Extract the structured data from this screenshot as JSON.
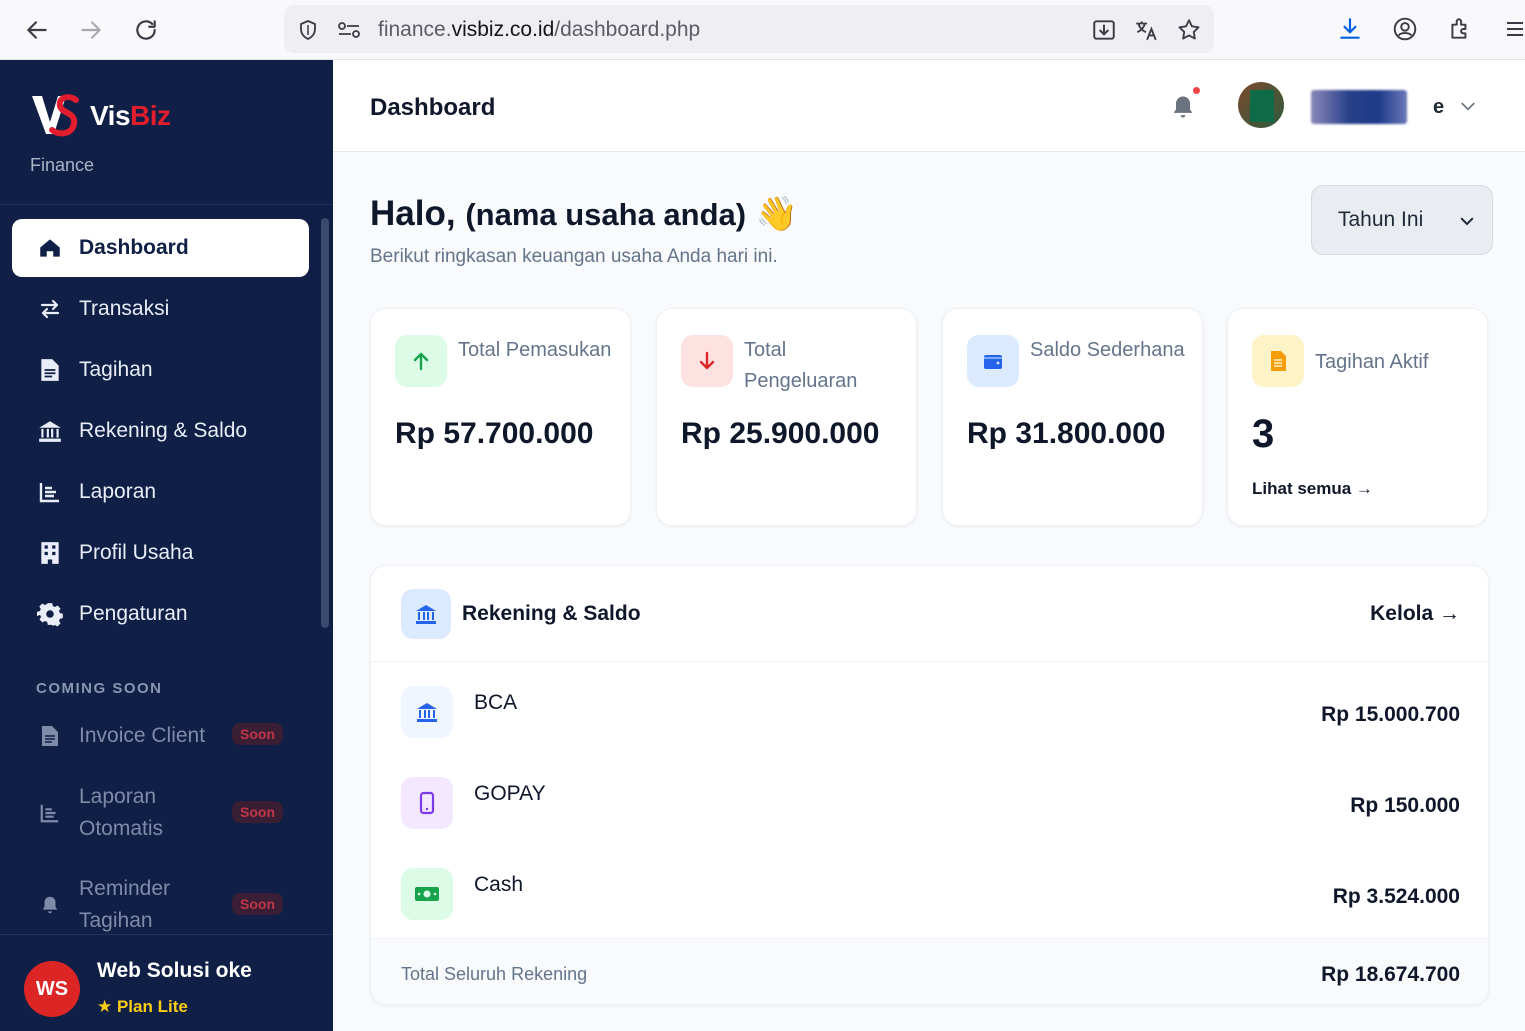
{
  "browser": {
    "url_prefix": "finance.",
    "url_domain": "visbiz.co.id",
    "url_path": "/dashboard.php"
  },
  "sidebar": {
    "brand_prefix": "Vis",
    "brand_suffix": "Biz",
    "brand_sub": "Finance",
    "items": [
      {
        "label": "Dashboard",
        "icon": "home-icon",
        "active": true
      },
      {
        "label": "Transaksi",
        "icon": "swap-arrows-icon"
      },
      {
        "label": "Tagihan",
        "icon": "document-icon"
      },
      {
        "label": "Rekening & Saldo",
        "icon": "bank-icon"
      },
      {
        "label": "Laporan",
        "icon": "chart-icon"
      },
      {
        "label": "Profil Usaha",
        "icon": "building-icon"
      },
      {
        "label": "Pengaturan",
        "icon": "gear-icon"
      }
    ],
    "section_label": "COMING SOON",
    "soon_items": [
      {
        "label": "Invoice Client",
        "badge": "Soon",
        "icon": "document-icon"
      },
      {
        "label": "Laporan Otomatis",
        "badge": "Soon",
        "icon": "chart-icon"
      },
      {
        "label": "Reminder Tagihan",
        "badge": "Soon",
        "icon": "bell-icon"
      }
    ],
    "footer": {
      "avatar_initials": "WS",
      "name": "Web Solusi oke",
      "plan": "★ Plan Lite"
    }
  },
  "header": {
    "title": "Dashboard",
    "user_name_suffix": "e"
  },
  "greeting": {
    "hello": "Halo,",
    "business": "(nama usaha anda)",
    "emoji": "👋",
    "subtitle": "Berikut ringkasan keuangan usaha Anda hari ini."
  },
  "period_select": {
    "value": "Tahun Ini"
  },
  "stats": [
    {
      "label": "Total Pemasukan",
      "value": "Rp 57.700.000",
      "icon": "arrow-up-icon",
      "color": "#16a34a",
      "bg": "#dcfce7"
    },
    {
      "label": "Total Pengeluaran",
      "value": "Rp 25.900.000",
      "icon": "arrow-down-icon",
      "color": "#dc2626",
      "bg": "#fee2e2"
    },
    {
      "label": "Saldo Sederhana",
      "value": "Rp 31.800.000",
      "icon": "wallet-icon",
      "color": "#2563eb",
      "bg": "#dbeafe"
    },
    {
      "label": "Tagihan Aktif",
      "value": "3",
      "link": "Lihat semua →",
      "icon": "invoice-icon",
      "color": "#f59e0b",
      "bg": "#fef3c7"
    }
  ],
  "accounts": {
    "title": "Rekening & Saldo",
    "manage_link": "Kelola →",
    "rows": [
      {
        "name": "BCA",
        "balance": "Rp 15.000.700",
        "icon": "bank-icon",
        "color": "#2563eb",
        "bg": "#eff6ff"
      },
      {
        "name": "GOPAY",
        "balance": "Rp 150.000",
        "icon": "phone-icon",
        "color": "#7c3aed",
        "bg": "#f3e8ff"
      },
      {
        "name": "Cash",
        "balance": "Rp 3.524.000",
        "icon": "cash-icon",
        "color": "#16a34a",
        "bg": "#dcfce7"
      }
    ],
    "total_label": "Total Seluruh Rekening",
    "total_value": "Rp 18.674.700"
  }
}
